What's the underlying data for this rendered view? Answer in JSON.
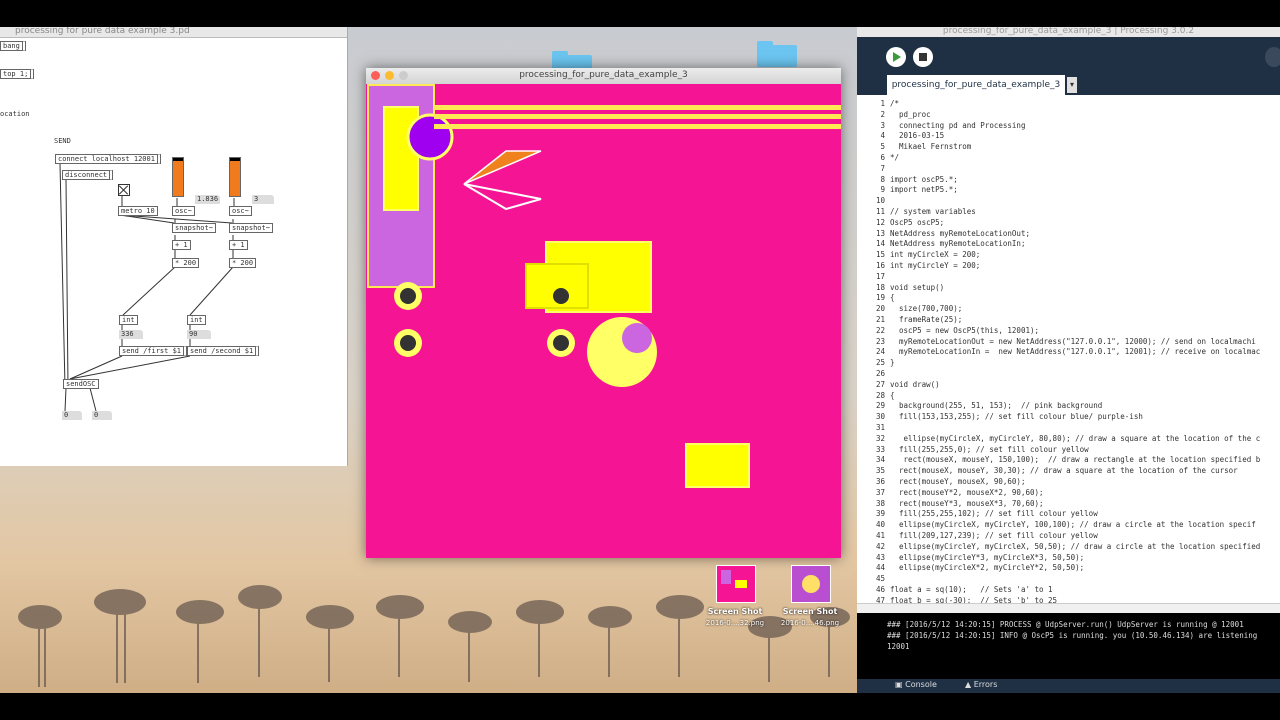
{
  "pd": {
    "window_title": "processing for pure data example 3.pd",
    "bang_label": "bang",
    "stop_label": "top 1;",
    "location_label": "ocation",
    "send_section_label": "SEND",
    "connect_msg": "connect localhost 12001",
    "disconnect_msg": "disconnect",
    "metro_obj": "metro 10",
    "osc1_obj": "osc~",
    "osc2_obj": "osc~",
    "osc_number": "1.836",
    "osc_number2": "3",
    "snapshot1": "snapshot~",
    "snapshot2": "snapshot~",
    "plus1a": "+ 1",
    "plus1b": "+ 1",
    "mul1": "* 200",
    "mul2": "* 200",
    "int1": "int",
    "int2": "int",
    "num1": "336",
    "num2": "90",
    "send_first": "send /first $1",
    "send_second": "send /second $1",
    "sendosc": "sendOSC",
    "out1": "0",
    "out2": "0"
  },
  "sketch": {
    "title": "processing_for_pure_data_example_3",
    "background_color": "#f51493"
  },
  "desktop": {
    "thumb1_label": "Screen Shot",
    "thumb1_sub": "2016-0....32.png",
    "thumb2_label": "Screen Shot",
    "thumb2_sub": "2016-0....46.png"
  },
  "ide": {
    "window_title": "processing_for_pure_data_example_3 | Processing 3.0.2",
    "tab_label": "processing_for_pure_data_example_3",
    "tab_menu": "▾",
    "code_lines": [
      "/*",
      "  pd_proc",
      "  connecting pd and Processing",
      "  2016-03-15",
      "  Mikael Fernstrom",
      "*/",
      "",
      "import oscP5.*;",
      "import netP5.*;",
      "",
      "// system variables",
      "OscP5 oscP5;",
      "NetAddress myRemoteLocationOut;",
      "NetAddress myRemoteLocationIn;",
      "int myCircleX = 200;",
      "int myCircleY = 200;",
      "",
      "void setup()",
      "{",
      "  size(700,700);",
      "  frameRate(25);",
      "  oscP5 = new OscP5(this, 12001);",
      "  myRemoteLocationOut = new NetAddress(\"127.0.0.1\", 12000); // send on localmachi",
      "  myRemoteLocationIn =  new NetAddress(\"127.0.0.1\", 12001); // receive on localmac",
      "}",
      "",
      "void draw()",
      "{",
      "  background(255, 51, 153);  // pink background",
      "  fill(153,153,255); // set fill colour blue/ purple-ish",
      "",
      "   ellipse(myCircleX, myCircleY, 80,80); // draw a square at the location of the c",
      "  fill(255,255,0); // set fill colour yellow",
      "   rect(mouseX, mouseY, 150,100);  // draw a rectangle at the location specified b",
      "  rect(mouseX, mouseY, 30,30); // draw a square at the location of the cursor",
      "  rect(mouseY, mouseX, 90,60);",
      "  rect(mouseY*2, mouseX*2, 90,60);",
      "  rect(mouseY*3, mouseX*3, 70,60);",
      "  fill(255,255,102); // set fill colour yellow",
      "  ellipse(myCircleX, myCircleY, 100,100); // draw a circle at the location specif",
      "  fill(209,127,239); // set fill colour yellow",
      "  ellipse(myCircleY, myCircleX, 50,50); // draw a circle at the location specified",
      "  ellipse(myCircleY*3, myCircleX*3, 50,50);",
      "  ellipse(myCircleX*2, myCircleY*2, 50,50);",
      "",
      "float a = sq(10);   // Sets 'a' to 1",
      "float b = sq(-30);  // Sets 'b' to 25"
    ],
    "console_lines": [
      "### [2016/5/12 14:20:15] PROCESS @ UdpServer.run() UdpServer is running @ 12001",
      "### [2016/5/12 14:20:15] INFO @ OscP5 is running. you (10.50.46.134) are listening",
      "12001"
    ],
    "console_tab": "Console",
    "errors_tab": "Errors"
  }
}
